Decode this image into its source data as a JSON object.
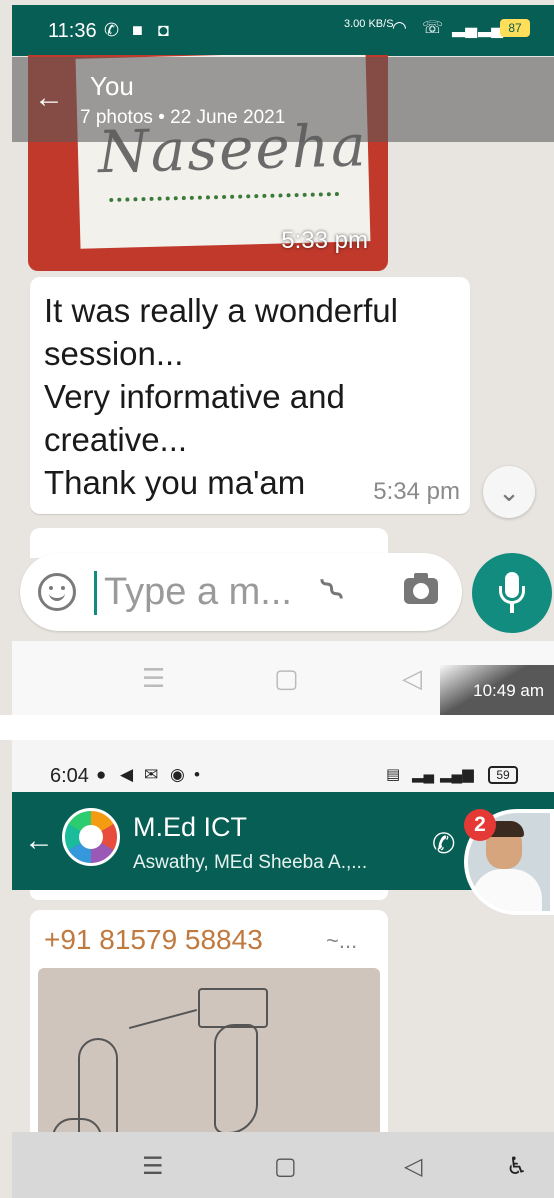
{
  "top": {
    "status_bar": {
      "time": "11:36",
      "net_speed": "3.00 KB/S",
      "battery": "87"
    },
    "viewer": {
      "sender": "You",
      "photo_count": "7 photos",
      "date": "22 June 2021"
    },
    "photo": {
      "caption_text": "Naseeha",
      "time": "5:33 pm"
    },
    "message": {
      "text": "It was really a wonderful\nsession...\nVery informative and\ncreative...\nThank you ma'am",
      "time": "5:34 pm"
    },
    "composer": {
      "placeholder": "Type a m..."
    },
    "screenshot_time": "10:49 am"
  },
  "bottom": {
    "status_bar": {
      "time": "6:04",
      "battery": "59"
    },
    "chat": {
      "group_name": "M.Ed ICT",
      "members": "Aswathy, MEd Sheeba A.,...",
      "unread_badge": "2"
    },
    "message": {
      "sender": "+91 81579 58843",
      "sender_suffix": "~..."
    }
  }
}
